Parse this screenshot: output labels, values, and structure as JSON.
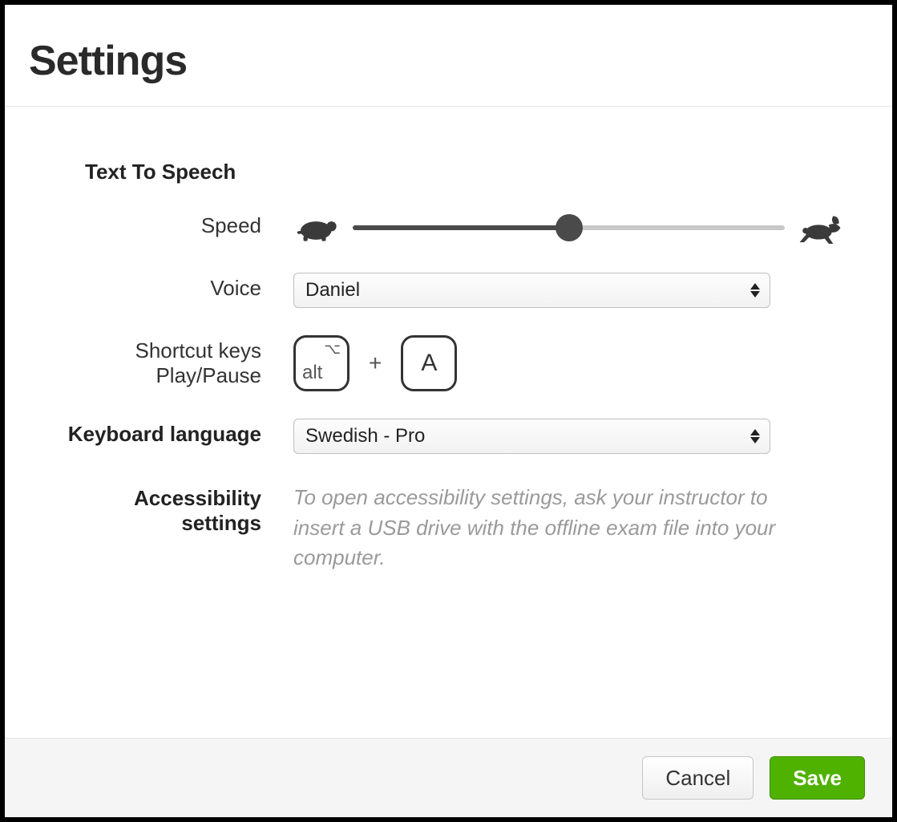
{
  "header": {
    "title": "Settings"
  },
  "tts": {
    "section_label": "Text To Speech",
    "speed": {
      "label": "Speed",
      "percent": 50,
      "slow_icon": "turtle-icon",
      "fast_icon": "rabbit-icon"
    },
    "voice": {
      "label": "Voice",
      "selected": "Daniel"
    },
    "shortcut": {
      "label_line1": "Shortcut keys",
      "label_line2": "Play/Pause",
      "key1": "alt",
      "key1_symbol": "⌥",
      "separator": "+",
      "key2": "A"
    }
  },
  "keyboard": {
    "label": "Keyboard language",
    "selected": "Swedish - Pro"
  },
  "accessibility": {
    "label": "Accessibility settings",
    "hint": "To open accessibility settings, ask your instructor to insert a USB drive with the offline exam file into your computer."
  },
  "footer": {
    "cancel": "Cancel",
    "save": "Save"
  }
}
